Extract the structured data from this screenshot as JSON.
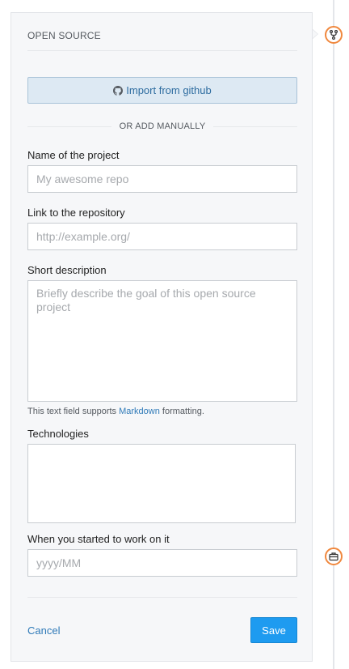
{
  "section": {
    "title": "OPEN SOURCE"
  },
  "import": {
    "label": "Import from github",
    "icon": "github-icon"
  },
  "divider": {
    "label": "OR ADD MANUALLY"
  },
  "fields": {
    "name": {
      "label": "Name of the project",
      "placeholder": "My awesome repo",
      "value": ""
    },
    "link": {
      "label": "Link to the repository",
      "placeholder": "http://example.org/",
      "value": ""
    },
    "description": {
      "label": "Short description",
      "placeholder": "Briefly describe the goal of this open source project",
      "value": "",
      "help_prefix": "This text field supports ",
      "help_link": "Markdown",
      "help_suffix": " formatting."
    },
    "technologies": {
      "label": "Technologies",
      "value": ""
    },
    "started": {
      "label": "When you started to work on it",
      "placeholder": "yyyy/MM",
      "value": ""
    }
  },
  "actions": {
    "cancel_label": "Cancel",
    "save_label": "Save"
  },
  "timeline": {
    "nodes": [
      "fork-icon",
      "briefcase-icon"
    ],
    "accent_color": "#f0883e"
  },
  "colors": {
    "card_background": "#f6f7f9",
    "primary_button": "#1e9bf0",
    "import_button": "#dde9f3",
    "link": "#2f7ab8"
  }
}
